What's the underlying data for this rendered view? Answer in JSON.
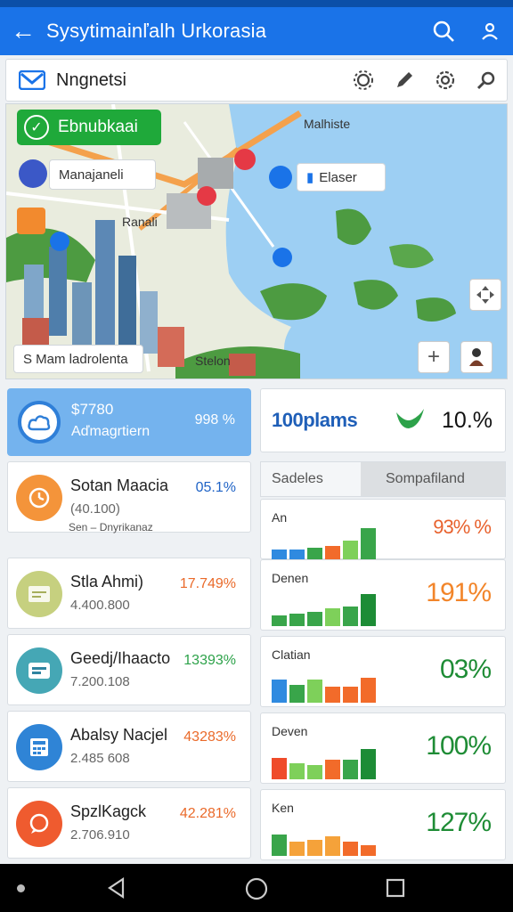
{
  "app_bar": {
    "back_icon": "arrow-left-icon",
    "title": "Sysytimainľalh Urkorasia",
    "search_icon": "search-icon",
    "profile_icon": "user-icon"
  },
  "toolbar": {
    "logo_icon": "mail-logo-icon",
    "title": "Nngnetsi",
    "icons": [
      "gear-icon",
      "pen-icon",
      "settings-icon",
      "search-icon"
    ]
  },
  "map": {
    "primary_button": "Ebnubkaai",
    "location_chip": "Manajaneli",
    "place_chip": "Elaser",
    "labels": [
      "Malhiste",
      "Ranali",
      "Stelon"
    ],
    "footer_chip": "S Mam ladrolenta",
    "zoom_in": "+",
    "colors": {
      "water": "#9dcff3",
      "land": "#e9ecde",
      "road": "#f4a14c",
      "park": "#4d9b41",
      "green_button": "#1fa93a"
    }
  },
  "summary": {
    "amount": "$7780",
    "subtitle": "Aďmagrtiern",
    "percent": "998 %",
    "background": "#74b3ee"
  },
  "plans": {
    "label": "100plams",
    "percent": "10.%",
    "bird_icon": "bird-icon"
  },
  "list": [
    {
      "name": "Sotan Maacia",
      "value": "(40.100)",
      "extra": "Sen – Dnyrikanaz",
      "percent": "05.1%",
      "percent_color": "#1f63c6",
      "icon_bg": "#f4943a",
      "icon": "clock-icon"
    },
    {
      "name": "Stla Ahmi)",
      "value": "4.400.800",
      "extra": "",
      "percent": "17.749%",
      "percent_color": "#ea6a2a",
      "icon_bg": "#c6d07f",
      "icon": "card-icon"
    },
    {
      "name": "Geedj/Ihaacto",
      "value": "7.200.108",
      "extra": "",
      "percent": "13393%",
      "percent_color": "#2da24a",
      "icon_bg": "#45a7b5",
      "icon": "wallet-icon"
    },
    {
      "name": "Abalsy Nacjel",
      "value": "2.485 608",
      "extra": "",
      "percent": "43283%",
      "percent_color": "#ea6a2a",
      "icon_bg": "#2f84d6",
      "icon": "calculator-icon"
    },
    {
      "name": "SpzlKagck",
      "value": "2.706.910",
      "extra": "",
      "percent": "42.281%",
      "percent_color": "#ea6a2a",
      "icon_bg": "#ef5b2f",
      "icon": "chat-icon"
    }
  ],
  "stats": {
    "tabs": [
      "Sadeles",
      "Sompafiland"
    ],
    "rows": [
      {
        "label": "An",
        "percent": "93% %",
        "percent_color": "#e8622e",
        "bars": [
          {
            "h": 0.3,
            "c": "#2f8ae0"
          },
          {
            "h": 0.3,
            "c": "#2f8ae0"
          },
          {
            "h": 0.35,
            "c": "#39a54a"
          },
          {
            "h": 0.4,
            "c": "#f26b2a"
          },
          {
            "h": 0.55,
            "c": "#7ed05a"
          },
          {
            "h": 0.9,
            "c": "#39a54a"
          }
        ]
      },
      {
        "label": "Denen",
        "percent": "191%",
        "percent_color": "#f2852a",
        "bars": [
          {
            "h": 0.3,
            "c": "#39a54a"
          },
          {
            "h": 0.35,
            "c": "#39a54a"
          },
          {
            "h": 0.4,
            "c": "#39a54a"
          },
          {
            "h": 0.5,
            "c": "#7ed05a"
          },
          {
            "h": 0.55,
            "c": "#39a54a"
          },
          {
            "h": 0.9,
            "c": "#1d8c36"
          }
        ]
      },
      {
        "label": "Clatian",
        "percent": "03%",
        "percent_color": "#1e8c35",
        "bars": [
          {
            "h": 0.65,
            "c": "#2f8ae0"
          },
          {
            "h": 0.5,
            "c": "#39a54a"
          },
          {
            "h": 0.65,
            "c": "#7ed05a"
          },
          {
            "h": 0.45,
            "c": "#f26b2a"
          },
          {
            "h": 0.45,
            "c": "#f26b2a"
          },
          {
            "h": 0.7,
            "c": "#f26b2a"
          }
        ]
      },
      {
        "label": "Deven",
        "percent": "100%",
        "percent_color": "#1e8c35",
        "bars": [
          {
            "h": 0.6,
            "c": "#ef4b2a"
          },
          {
            "h": 0.45,
            "c": "#7ed05a"
          },
          {
            "h": 0.4,
            "c": "#7ed05a"
          },
          {
            "h": 0.55,
            "c": "#f26b2a"
          },
          {
            "h": 0.55,
            "c": "#39a54a"
          },
          {
            "h": 0.85,
            "c": "#1d8c36"
          }
        ]
      },
      {
        "label": "Ken",
        "percent": "127%",
        "percent_color": "#1e8c35",
        "bars": [
          {
            "h": 0.6,
            "c": "#39a54a"
          },
          {
            "h": 0.4,
            "c": "#f5a23a"
          },
          {
            "h": 0.45,
            "c": "#f5a23a"
          },
          {
            "h": 0.55,
            "c": "#f5a23a"
          },
          {
            "h": 0.4,
            "c": "#f26b2a"
          },
          {
            "h": 0.3,
            "c": "#f26b2a"
          }
        ]
      }
    ]
  },
  "nav": {
    "back_icon": "triangle-back-icon",
    "home_icon": "circle-home-icon",
    "recents_icon": "square-recents-icon"
  }
}
